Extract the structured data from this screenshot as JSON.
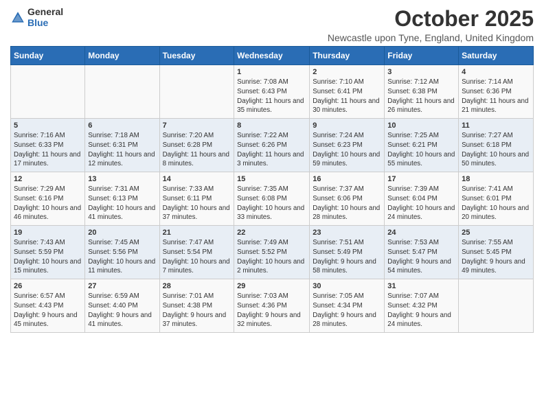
{
  "logo": {
    "general": "General",
    "blue": "Blue"
  },
  "header": {
    "title": "October 2025",
    "subtitle": "Newcastle upon Tyne, England, United Kingdom"
  },
  "days": [
    "Sunday",
    "Monday",
    "Tuesday",
    "Wednesday",
    "Thursday",
    "Friday",
    "Saturday"
  ],
  "weeks": [
    [
      {
        "num": "",
        "sunrise": "",
        "sunset": "",
        "daylight": ""
      },
      {
        "num": "",
        "sunrise": "",
        "sunset": "",
        "daylight": ""
      },
      {
        "num": "",
        "sunrise": "",
        "sunset": "",
        "daylight": ""
      },
      {
        "num": "1",
        "sunrise": "Sunrise: 7:08 AM",
        "sunset": "Sunset: 6:43 PM",
        "daylight": "Daylight: 11 hours and 35 minutes."
      },
      {
        "num": "2",
        "sunrise": "Sunrise: 7:10 AM",
        "sunset": "Sunset: 6:41 PM",
        "daylight": "Daylight: 11 hours and 30 minutes."
      },
      {
        "num": "3",
        "sunrise": "Sunrise: 7:12 AM",
        "sunset": "Sunset: 6:38 PM",
        "daylight": "Daylight: 11 hours and 26 minutes."
      },
      {
        "num": "4",
        "sunrise": "Sunrise: 7:14 AM",
        "sunset": "Sunset: 6:36 PM",
        "daylight": "Daylight: 11 hours and 21 minutes."
      }
    ],
    [
      {
        "num": "5",
        "sunrise": "Sunrise: 7:16 AM",
        "sunset": "Sunset: 6:33 PM",
        "daylight": "Daylight: 11 hours and 17 minutes."
      },
      {
        "num": "6",
        "sunrise": "Sunrise: 7:18 AM",
        "sunset": "Sunset: 6:31 PM",
        "daylight": "Daylight: 11 hours and 12 minutes."
      },
      {
        "num": "7",
        "sunrise": "Sunrise: 7:20 AM",
        "sunset": "Sunset: 6:28 PM",
        "daylight": "Daylight: 11 hours and 8 minutes."
      },
      {
        "num": "8",
        "sunrise": "Sunrise: 7:22 AM",
        "sunset": "Sunset: 6:26 PM",
        "daylight": "Daylight: 11 hours and 3 minutes."
      },
      {
        "num": "9",
        "sunrise": "Sunrise: 7:24 AM",
        "sunset": "Sunset: 6:23 PM",
        "daylight": "Daylight: 10 hours and 59 minutes."
      },
      {
        "num": "10",
        "sunrise": "Sunrise: 7:25 AM",
        "sunset": "Sunset: 6:21 PM",
        "daylight": "Daylight: 10 hours and 55 minutes."
      },
      {
        "num": "11",
        "sunrise": "Sunrise: 7:27 AM",
        "sunset": "Sunset: 6:18 PM",
        "daylight": "Daylight: 10 hours and 50 minutes."
      }
    ],
    [
      {
        "num": "12",
        "sunrise": "Sunrise: 7:29 AM",
        "sunset": "Sunset: 6:16 PM",
        "daylight": "Daylight: 10 hours and 46 minutes."
      },
      {
        "num": "13",
        "sunrise": "Sunrise: 7:31 AM",
        "sunset": "Sunset: 6:13 PM",
        "daylight": "Daylight: 10 hours and 41 minutes."
      },
      {
        "num": "14",
        "sunrise": "Sunrise: 7:33 AM",
        "sunset": "Sunset: 6:11 PM",
        "daylight": "Daylight: 10 hours and 37 minutes."
      },
      {
        "num": "15",
        "sunrise": "Sunrise: 7:35 AM",
        "sunset": "Sunset: 6:08 PM",
        "daylight": "Daylight: 10 hours and 33 minutes."
      },
      {
        "num": "16",
        "sunrise": "Sunrise: 7:37 AM",
        "sunset": "Sunset: 6:06 PM",
        "daylight": "Daylight: 10 hours and 28 minutes."
      },
      {
        "num": "17",
        "sunrise": "Sunrise: 7:39 AM",
        "sunset": "Sunset: 6:04 PM",
        "daylight": "Daylight: 10 hours and 24 minutes."
      },
      {
        "num": "18",
        "sunrise": "Sunrise: 7:41 AM",
        "sunset": "Sunset: 6:01 PM",
        "daylight": "Daylight: 10 hours and 20 minutes."
      }
    ],
    [
      {
        "num": "19",
        "sunrise": "Sunrise: 7:43 AM",
        "sunset": "Sunset: 5:59 PM",
        "daylight": "Daylight: 10 hours and 15 minutes."
      },
      {
        "num": "20",
        "sunrise": "Sunrise: 7:45 AM",
        "sunset": "Sunset: 5:56 PM",
        "daylight": "Daylight: 10 hours and 11 minutes."
      },
      {
        "num": "21",
        "sunrise": "Sunrise: 7:47 AM",
        "sunset": "Sunset: 5:54 PM",
        "daylight": "Daylight: 10 hours and 7 minutes."
      },
      {
        "num": "22",
        "sunrise": "Sunrise: 7:49 AM",
        "sunset": "Sunset: 5:52 PM",
        "daylight": "Daylight: 10 hours and 2 minutes."
      },
      {
        "num": "23",
        "sunrise": "Sunrise: 7:51 AM",
        "sunset": "Sunset: 5:49 PM",
        "daylight": "Daylight: 9 hours and 58 minutes."
      },
      {
        "num": "24",
        "sunrise": "Sunrise: 7:53 AM",
        "sunset": "Sunset: 5:47 PM",
        "daylight": "Daylight: 9 hours and 54 minutes."
      },
      {
        "num": "25",
        "sunrise": "Sunrise: 7:55 AM",
        "sunset": "Sunset: 5:45 PM",
        "daylight": "Daylight: 9 hours and 49 minutes."
      }
    ],
    [
      {
        "num": "26",
        "sunrise": "Sunrise: 6:57 AM",
        "sunset": "Sunset: 4:43 PM",
        "daylight": "Daylight: 9 hours and 45 minutes."
      },
      {
        "num": "27",
        "sunrise": "Sunrise: 6:59 AM",
        "sunset": "Sunset: 4:40 PM",
        "daylight": "Daylight: 9 hours and 41 minutes."
      },
      {
        "num": "28",
        "sunrise": "Sunrise: 7:01 AM",
        "sunset": "Sunset: 4:38 PM",
        "daylight": "Daylight: 9 hours and 37 minutes."
      },
      {
        "num": "29",
        "sunrise": "Sunrise: 7:03 AM",
        "sunset": "Sunset: 4:36 PM",
        "daylight": "Daylight: 9 hours and 32 minutes."
      },
      {
        "num": "30",
        "sunrise": "Sunrise: 7:05 AM",
        "sunset": "Sunset: 4:34 PM",
        "daylight": "Daylight: 9 hours and 28 minutes."
      },
      {
        "num": "31",
        "sunrise": "Sunrise: 7:07 AM",
        "sunset": "Sunset: 4:32 PM",
        "daylight": "Daylight: 9 hours and 24 minutes."
      },
      {
        "num": "",
        "sunrise": "",
        "sunset": "",
        "daylight": ""
      }
    ]
  ]
}
